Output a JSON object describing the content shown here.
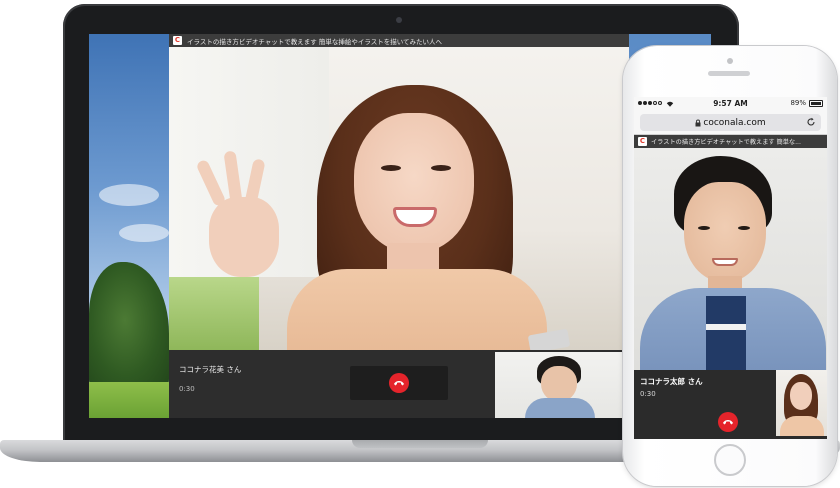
{
  "laptop": {
    "browser": {
      "favicon_letter": "C",
      "tab_title": "イラストの描き方ビデオチャットで教えます 簡単な挿絵やイラストを描いてみたい人へ"
    },
    "call": {
      "caller_name": "ココナラ花美 さん",
      "timer": "0:30"
    }
  },
  "phone": {
    "status_bar": {
      "time": "9:57 AM",
      "battery": "89%"
    },
    "url": "coconala.com",
    "tab": {
      "favicon_letter": "C",
      "title": "イラストの描き方ビデオチャットで教えます 簡単な..."
    },
    "call": {
      "caller_name": "ココナラ太郎 さん",
      "timer": "0:30"
    }
  },
  "colors": {
    "hangup": "#e5242b",
    "call_bar": "#2d2d2d",
    "titlebar": "#3c3c3c"
  },
  "icons": [
    "hangup-icon",
    "lock-icon",
    "reload-icon",
    "wifi-icon",
    "battery-icon",
    "signal-icon"
  ]
}
